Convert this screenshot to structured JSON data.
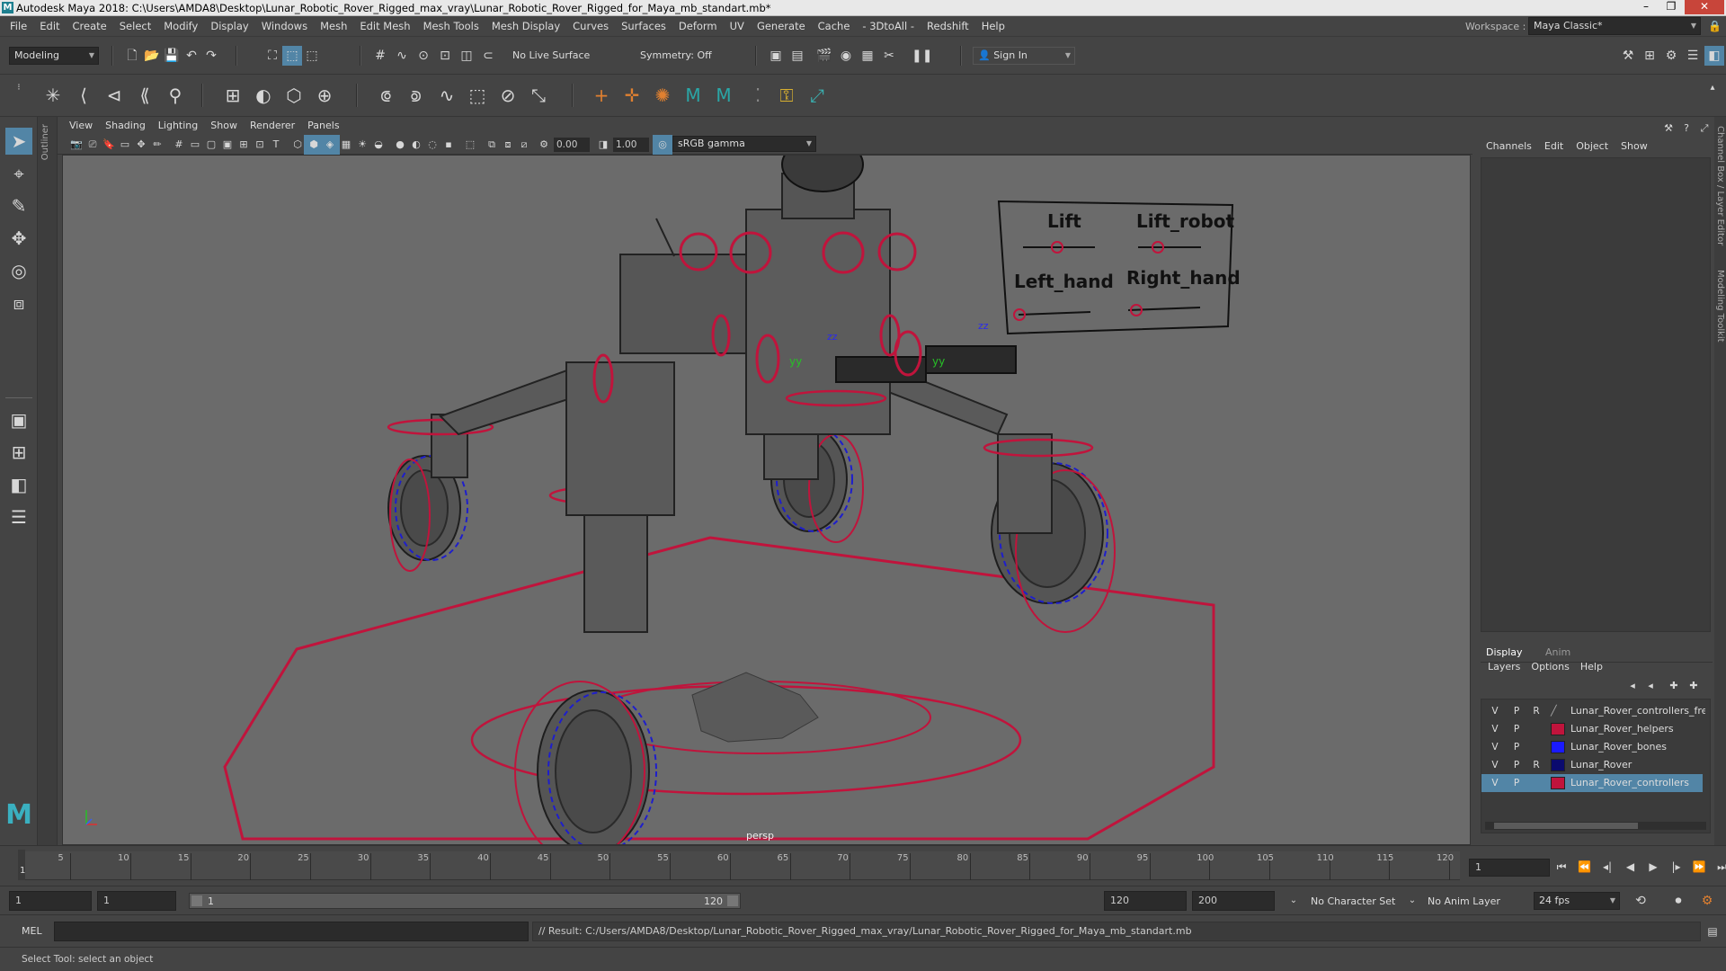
{
  "window": {
    "title": "Autodesk Maya 2018: C:\\Users\\AMDA8\\Desktop\\Lunar_Robotic_Rover_Rigged_max_vray\\Lunar_Robotic_Rover_Rigged_for_Maya_mb_standart.mb*",
    "app_icon": "M",
    "minimize": "–",
    "maximize": "❐",
    "close": "✕"
  },
  "menubar": {
    "items": [
      "File",
      "Edit",
      "Create",
      "Select",
      "Modify",
      "Display",
      "Windows",
      "Mesh",
      "Edit Mesh",
      "Mesh Tools",
      "Mesh Display",
      "Curves",
      "Surfaces",
      "Deform",
      "UV",
      "Generate",
      "Cache",
      "- 3DtoAll -",
      "Redshift",
      "Help"
    ],
    "workspace_label": "Workspace :",
    "workspace_value": "Maya Classic*"
  },
  "status_line": {
    "mode": "Modeling",
    "live_surface": "No Live Surface",
    "symmetry": "Symmetry: Off",
    "sign_in": "Sign In"
  },
  "panel": {
    "menus": [
      "View",
      "Shading",
      "Lighting",
      "Show",
      "Renderer",
      "Panels"
    ],
    "exposure": "0.00",
    "gamma": "1.00",
    "color_space": "sRGB gamma",
    "camera_label": "persp"
  },
  "viewport": {
    "picker_labels": [
      "Lift",
      "Lift_robot",
      "Left_hand",
      "Right_hand"
    ],
    "axis_labels": [
      "zz",
      "yy",
      "zz",
      "yy",
      "zz"
    ]
  },
  "outliner_tab": "Outliner",
  "channel_box": {
    "menus": [
      "Channels",
      "Edit",
      "Object",
      "Show"
    ],
    "side_tabs": [
      "Channel Box / Layer Editor",
      "Modeling Toolkit"
    ]
  },
  "layer_editor": {
    "tabs": [
      "Display",
      "Anim"
    ],
    "menus": [
      "Layers",
      "Options",
      "Help"
    ],
    "layers": [
      {
        "v": "V",
        "p": "P",
        "r": "R",
        "color": "",
        "name": "Lunar_Rover_controllers_freeze",
        "selected": false
      },
      {
        "v": "V",
        "p": "P",
        "r": "",
        "color": "#c0143c",
        "name": "Lunar_Rover_helpers",
        "selected": false
      },
      {
        "v": "V",
        "p": "P",
        "r": "",
        "color": "#1a1aff",
        "name": "Lunar_Rover_bones",
        "selected": false
      },
      {
        "v": "V",
        "p": "P",
        "r": "R",
        "color": "#0a0a6e",
        "name": "Lunar_Rover",
        "selected": false
      },
      {
        "v": "V",
        "p": "P",
        "r": "",
        "color": "#c0143c",
        "name": "Lunar_Rover_controllers",
        "selected": true
      }
    ]
  },
  "timeline": {
    "ticks": [
      "5",
      "10",
      "15",
      "20",
      "25",
      "30",
      "35",
      "40",
      "45",
      "50",
      "55",
      "60",
      "65",
      "70",
      "75",
      "80",
      "85",
      "90",
      "95",
      "100",
      "105",
      "110",
      "115",
      "120"
    ],
    "start_tick": "1",
    "current_frame": "1"
  },
  "range": {
    "start": "1",
    "playback_start": "1",
    "slider_start": "1",
    "slider_end": "120",
    "playback_end": "120",
    "end": "200",
    "character_set": "No Character Set",
    "anim_layer": "No Anim Layer",
    "fps": "24 fps"
  },
  "command": {
    "lang": "MEL",
    "result": "// Result: C:/Users/AMDA8/Desktop/Lunar_Robotic_Rover_Rigged_max_vray/Lunar_Robotic_Rover_Rigged_for_Maya_mb_standart.mb"
  },
  "help_line": "Select Tool: select an object",
  "colors": {
    "controller_red": "#c0143c",
    "bone_blue": "#1e1ecc",
    "highlight": "#5285a6",
    "viewport_bg": "#6b6b6b"
  }
}
